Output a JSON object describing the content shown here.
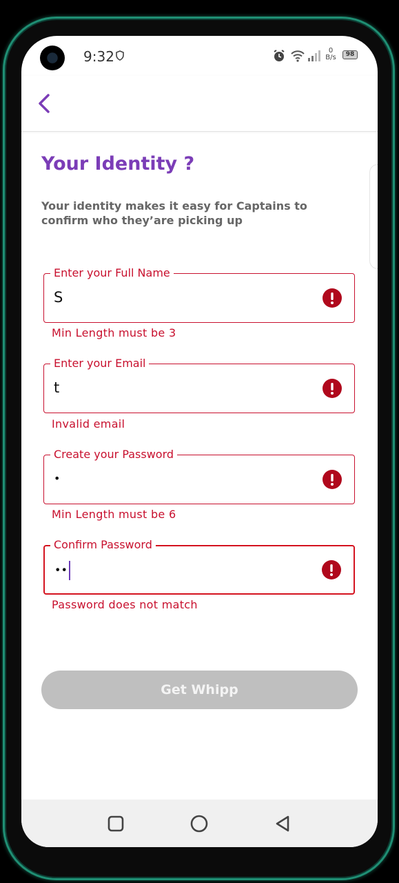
{
  "status_bar": {
    "time": "9:32",
    "net_speed_value": "0",
    "net_speed_unit": "B/s",
    "battery": "98"
  },
  "header": {
    "title": "Your Identity ?",
    "subtitle": "Your identity makes it easy for Captains to confirm who they’are picking up"
  },
  "form": {
    "fields": [
      {
        "label": "Enter your Full Name",
        "value": "S",
        "error": "Min Length must be 3"
      },
      {
        "label": "Enter your Email",
        "value": "t",
        "error": "Invalid email"
      },
      {
        "label": "Create your Password",
        "value": "•",
        "error": "Min Length must be 6"
      },
      {
        "label": "Confirm Password",
        "value": "••",
        "error": "Password does not match"
      }
    ],
    "submit_label": "Get Whipp"
  },
  "colors": {
    "accent": "#7b3db7",
    "error": "#c8102e",
    "button_disabled": "#bfbfbf"
  },
  "icons": {
    "back": "chevron-left-icon",
    "error": "exclamation-circle-icon",
    "nav_recent": "square-icon",
    "nav_home": "circle-icon",
    "nav_back": "triangle-back-icon"
  }
}
